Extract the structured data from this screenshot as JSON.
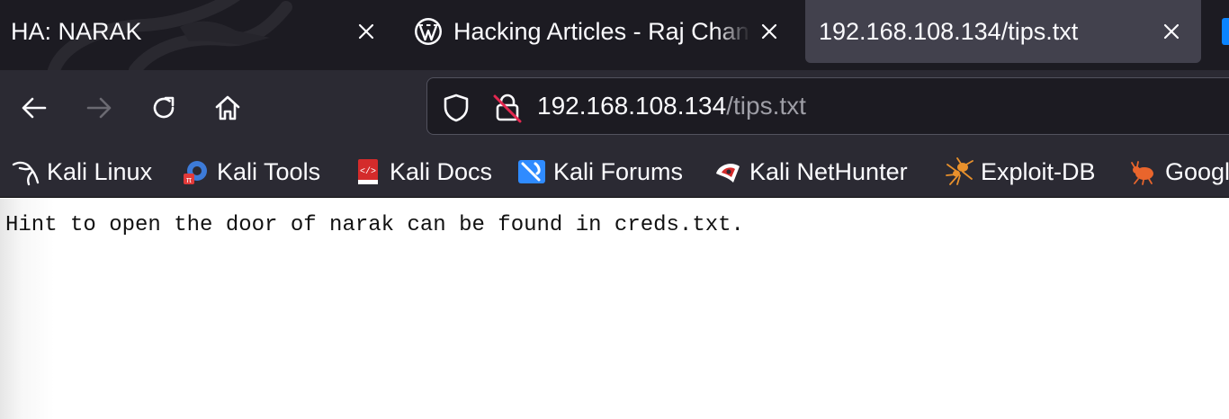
{
  "tabs": [
    {
      "title": "HA: NARAK",
      "icon": "kali-dragon-watermark",
      "active": false
    },
    {
      "title": "Hacking Articles - Raj Chandel",
      "icon": "wordpress-icon",
      "active": false
    },
    {
      "title": "192.168.108.134/tips.txt",
      "icon": "",
      "active": true
    }
  ],
  "toolbar": {
    "back_icon": "arrow-left-icon",
    "forward_icon": "arrow-right-icon",
    "reload_icon": "reload-icon",
    "home_icon": "home-icon"
  },
  "urlbar": {
    "host": "192.168.108.134",
    "path": "/tips.txt",
    "shield_icon": "shield-icon",
    "lock_icon": "insecure-lock-icon"
  },
  "bookmarks": [
    {
      "label": "Kali Linux",
      "icon": "kali-dragon-icon"
    },
    {
      "label": "Kali Tools",
      "icon": "kali-tools-icon"
    },
    {
      "label": "Kali Docs",
      "icon": "kali-docs-icon"
    },
    {
      "label": "Kali Forums",
      "icon": "kali-forums-icon"
    },
    {
      "label": "Kali NetHunter",
      "icon": "nethunter-icon"
    },
    {
      "label": "Exploit-DB",
      "icon": "exploit-db-spider-icon"
    },
    {
      "label": "Google Hacking DB",
      "icon": "ghdb-bug-icon"
    }
  ],
  "page": {
    "text": "Hint to open the door of narak can be found in creds.txt."
  },
  "colors": {
    "tabstrip_bg": "#1c1b22",
    "active_tab_bg": "#42414d",
    "toolbar_bg": "#2b2a33",
    "urlbar_bg": "#1c1b22",
    "text_light": "#fbfbfe",
    "url_path": "#9e9ea6",
    "insecure_red": "#e22850"
  }
}
